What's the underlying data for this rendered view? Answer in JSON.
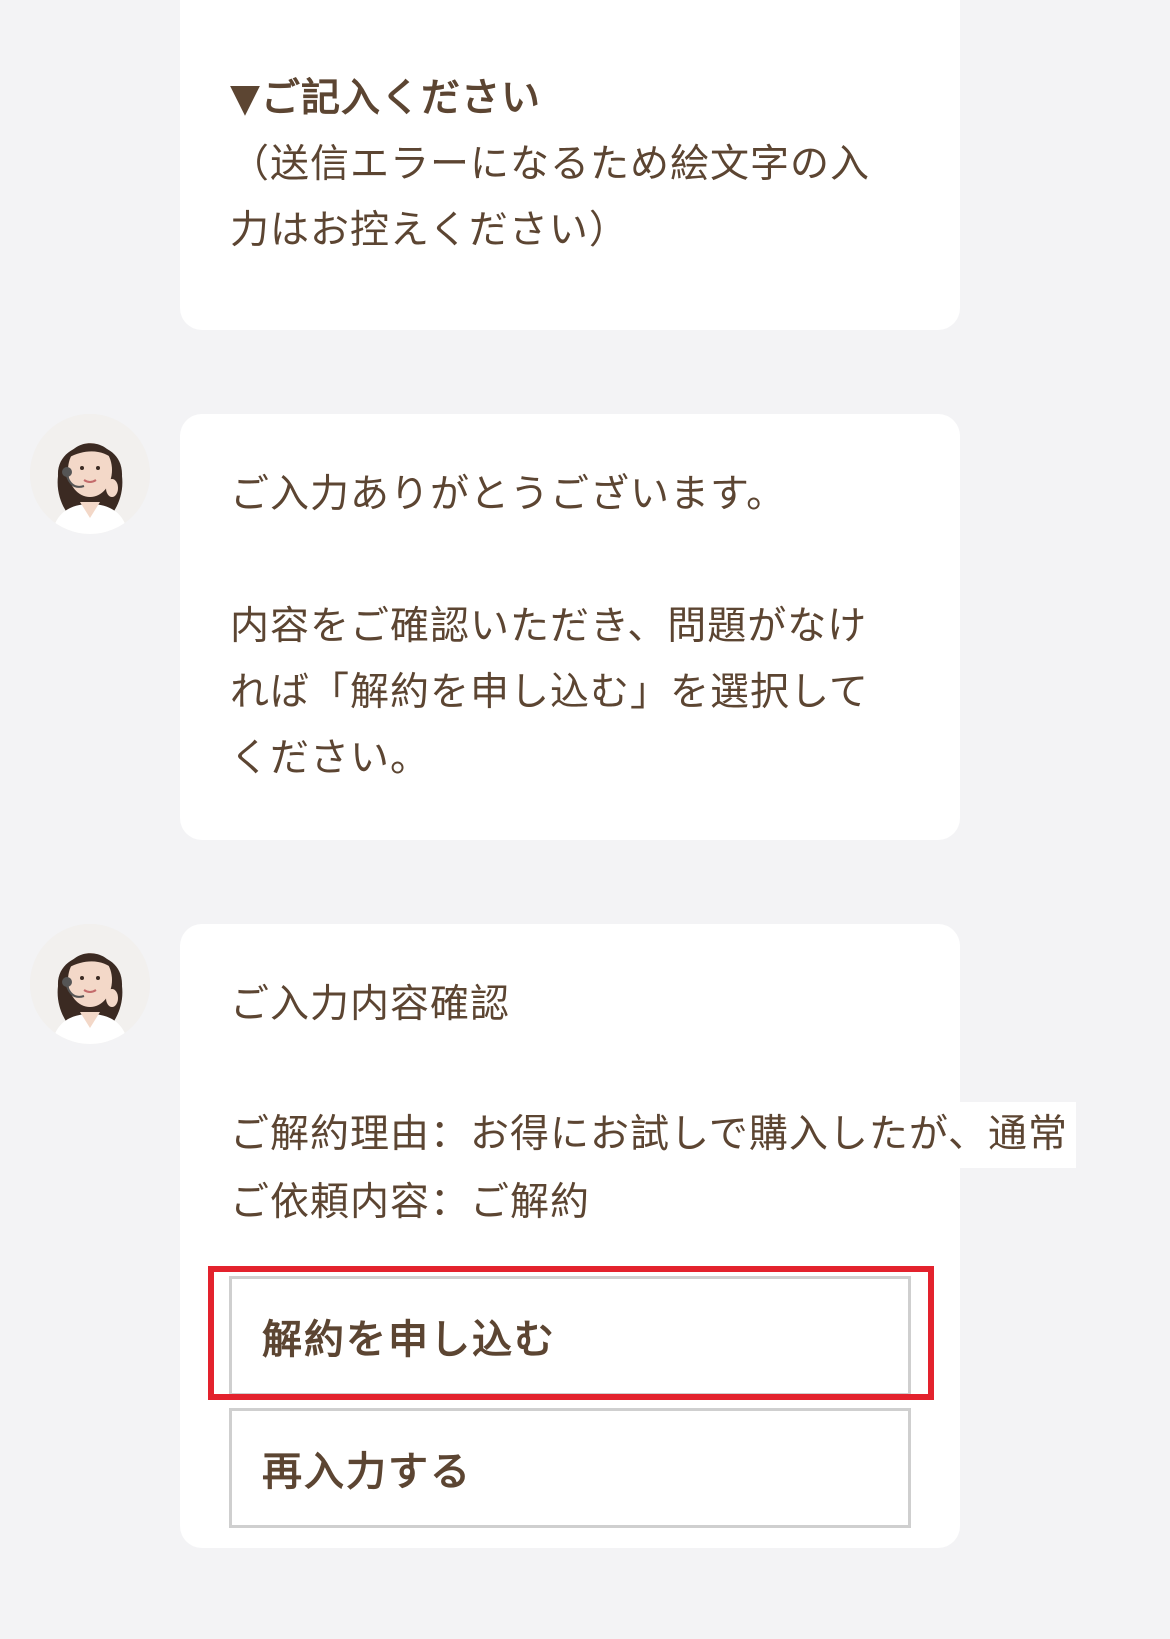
{
  "messages": [
    {
      "lines": [
        "▼ご記入ください",
        "（送信エラーになるため絵文字の入",
        "力はお控えください）"
      ]
    },
    {
      "lines": [
        "ご入力ありがとうございます。",
        "内容をご確認いただき、問題がなけ",
        "れば「解約を申し込む」を選択して",
        "ください。"
      ]
    },
    {
      "title": "ご入力内容確認",
      "reason": "ご解約理由：お得にお試しで購入したが、通常",
      "request": "ご依頼内容：ご解約",
      "buttons": {
        "apply": "解約を申し込む",
        "reenter": "再入力する"
      }
    }
  ],
  "colors": {
    "text": "#5c4532",
    "background": "#f3f3f5",
    "bubble": "#ffffff",
    "highlight": "#e3222d",
    "button_border": "#cfcfcf"
  },
  "icons": {
    "avatar": "operator-avatar-icon"
  }
}
